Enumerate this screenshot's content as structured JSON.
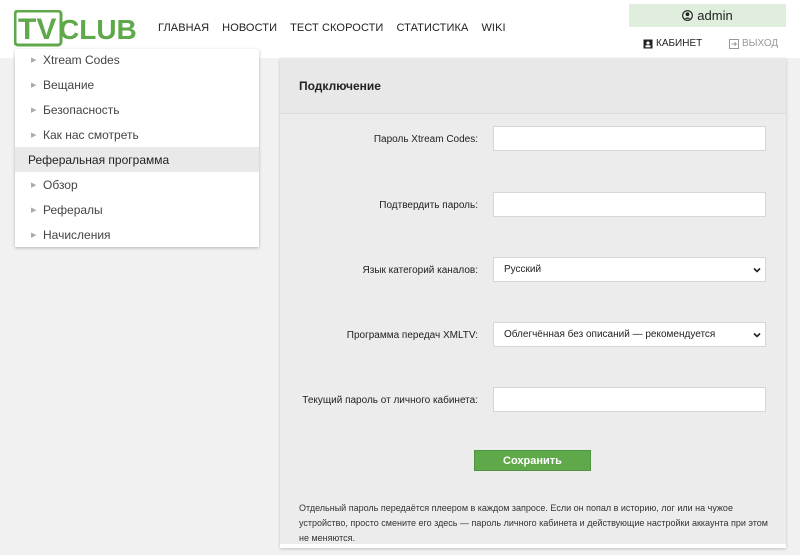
{
  "colors": {
    "brand_green": "#5fa94b",
    "user_box_bg": "#dfeedd",
    "active_item_bg": "#e9e9e9"
  },
  "logo": {
    "text_tv": "TV",
    "text_club": "CLUB"
  },
  "nav": [
    "ГЛАВНАЯ",
    "НОВОСТИ",
    "ТЕСТ СКОРОСТИ",
    "СТАТИСТИКА",
    "WIKI"
  ],
  "user": {
    "name": "admin",
    "icon": "user-circle-icon"
  },
  "cabinet": {
    "label": "КАБИНЕТ",
    "icon": "cabinet-icon"
  },
  "exit": {
    "label": "ВЫХОД",
    "icon": "exit-icon"
  },
  "sidebar": {
    "items": [
      {
        "label": "Xtream Codes",
        "type": "sub"
      },
      {
        "label": "Вещание",
        "type": "sub"
      },
      {
        "label": "Безопасность",
        "type": "sub"
      },
      {
        "label": "Как нас смотреть",
        "type": "sub"
      },
      {
        "label": "Реферальная программа",
        "type": "section"
      },
      {
        "label": "Обзор",
        "type": "sub"
      },
      {
        "label": "Рефералы",
        "type": "sub"
      },
      {
        "label": "Начисления",
        "type": "sub"
      }
    ]
  },
  "panel": {
    "title": "Подключение",
    "fields": [
      {
        "label": "Пароль Xtream Codes:",
        "kind": "input",
        "value": ""
      },
      {
        "label": "Подтвердить пароль:",
        "kind": "input",
        "value": ""
      },
      {
        "label": "Язык категорий каналов:",
        "kind": "select",
        "value": "Русский"
      },
      {
        "label": "Программа передач XMLTV:",
        "kind": "select",
        "value": "Облегчённая без описаний — рекомендуется"
      },
      {
        "label": "Текущий пароль от личного кабинета:",
        "kind": "input",
        "value": ""
      }
    ],
    "save_label": "Сохранить",
    "note": "Отдельный пароль передаётся плеером в каждом запросе. Если он попал в историю, лог или на чужое устройство, просто смените его здесь — пароль личного кабинета и действующие настройки аккаунта при этом не меняются."
  }
}
